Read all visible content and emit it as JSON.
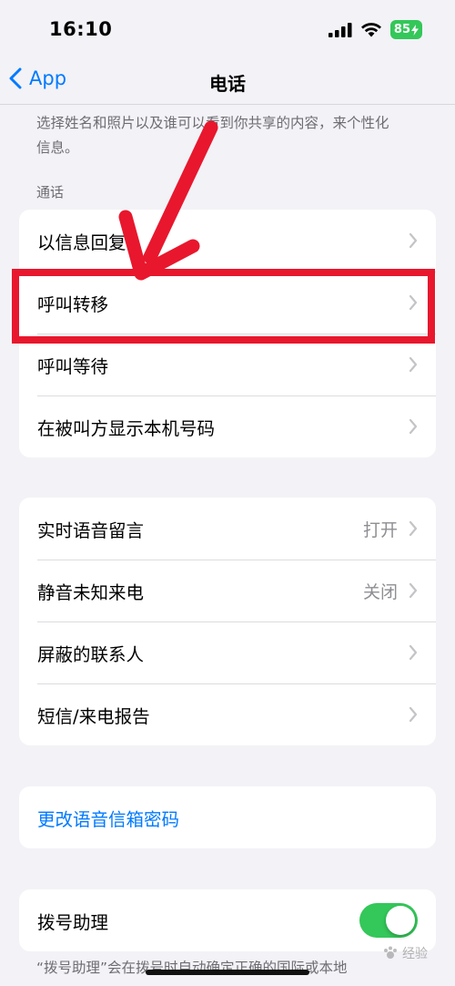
{
  "status_bar": {
    "time": "16:10",
    "battery_level": "85"
  },
  "navbar": {
    "back_label": "App",
    "title": "电话"
  },
  "intro_text": "选择姓名和照片以及谁可以看到你共享的内容，来个性化信息。",
  "calls_section": {
    "header": "通话",
    "items": [
      {
        "label": "以信息回复"
      },
      {
        "label": "呼叫转移"
      },
      {
        "label": "呼叫等待"
      },
      {
        "label": "在被叫方显示本机号码"
      }
    ]
  },
  "voicemail_section": {
    "items": [
      {
        "label": "实时语音留言",
        "value": "打开"
      },
      {
        "label": "静音未知来电",
        "value": "关闭"
      },
      {
        "label": "屏蔽的联系人",
        "value": ""
      },
      {
        "label": "短信/来电报告",
        "value": ""
      }
    ]
  },
  "voicemail_password": {
    "label": "更改语音信箱密码"
  },
  "dial_assist": {
    "label": "拨号助理",
    "enabled": true,
    "footer": "“拨号助理”会在拨号时自动确定正确的国际或本地"
  },
  "annotation": {
    "highlight_color": "#e8172d"
  },
  "watermark": "经验"
}
